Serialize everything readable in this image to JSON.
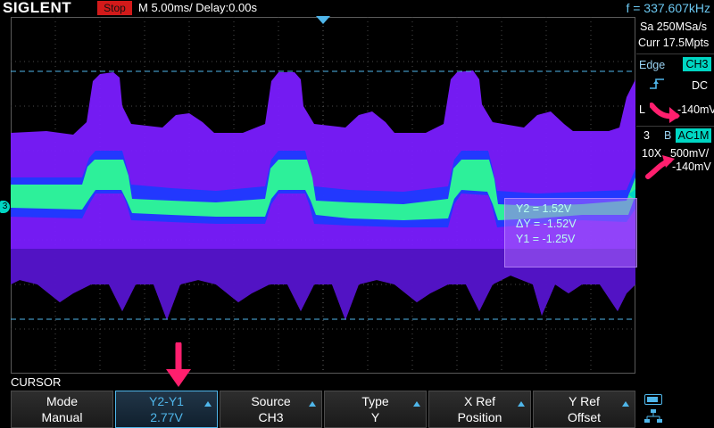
{
  "header": {
    "brand": "SIGLENT",
    "run_status": "Stop",
    "timebase": "M 5.00ms/ Delay:0.00s",
    "frequency": "f = 337.607kHz"
  },
  "acquisition": {
    "sample_rate": "Sa 250MSa/s",
    "memory_depth": "Curr 17.5Mpts"
  },
  "trigger": {
    "type": "Edge",
    "source": "CH3",
    "slope_icon": "rising-edge-icon",
    "coupling": "DC",
    "level_label": "L",
    "level": "-140mV"
  },
  "channel": {
    "number": "3",
    "bw_limit": "B",
    "coupling": "AC1M",
    "probe": "10X",
    "scale": "500mV/",
    "offset": "-140mV",
    "marker": "3"
  },
  "cursor_readout": {
    "line1": "Y2 = 1.52V",
    "line2": "ΔY = -1.52V",
    "line3": "Y1 = -1.25V"
  },
  "menu": {
    "title": "CURSOR",
    "softkeys": [
      {
        "label": "Mode",
        "value": "Manual"
      },
      {
        "label": "Y2-Y1",
        "value": "2.77V"
      },
      {
        "label": "Source",
        "value": "CH3"
      },
      {
        "label": "Type",
        "value": "Y"
      },
      {
        "label": "X Ref",
        "value": "Position"
      },
      {
        "label": "Y Ref",
        "value": "Offset"
      }
    ]
  },
  "colors": {
    "accent": "#4fb6ea",
    "channel3": "#00d6c3",
    "stop": "#d21a1a",
    "persistence_high": "#2df09a",
    "persistence_mid": "#1a3cff",
    "persistence_low": "#7a1cff",
    "annotation": "#ff1f6e"
  }
}
